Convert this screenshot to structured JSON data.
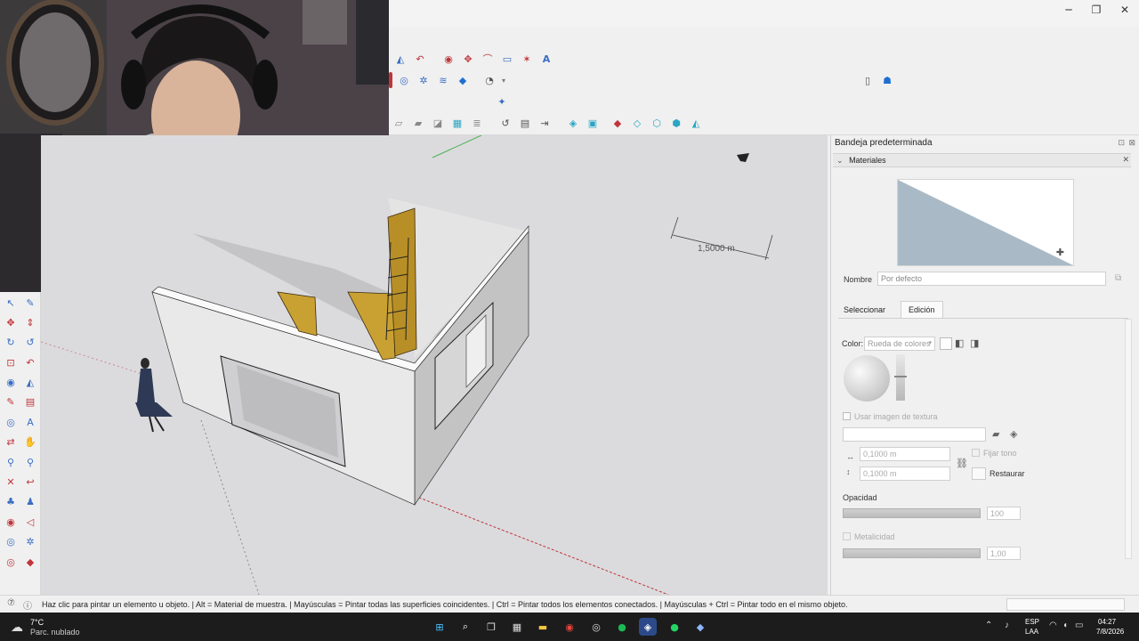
{
  "window": {
    "minimize_glyph": "─",
    "maximize_glyph": "❐",
    "close_glyph": "✕"
  },
  "toolbar": {
    "row1_icons": [
      "protractor-icon",
      "arc-icon",
      "tape-icon",
      "dimension-icon",
      "pie-icon",
      "text-icon",
      "axes-icon",
      "3d-text-icon"
    ],
    "row2_icons": [
      "orbit-icon",
      "pan-icon",
      "zoom-icon",
      "paint-icon",
      "user-icon"
    ],
    "row3_icons": [
      "sandbox-icon",
      "stamp-icon",
      "drape-icon",
      "add-detail-icon",
      "flip-icon",
      "warehouse-icon",
      "extension-icon"
    ],
    "right_icons": [
      "document-icon",
      "profile-icon"
    ]
  },
  "left_tools": [
    "select-icon",
    "pencil-icon",
    "move-icon",
    "push-pull-icon",
    "rotate-icon",
    "follow-me-icon",
    "scale-icon",
    "offset-icon",
    "tape-measure-icon",
    "protractor-icon",
    "paint-bucket-icon",
    "text-icon",
    "orbit-icon",
    "axes-icon",
    "section-plane-icon",
    "pan-icon",
    "zoom-icon",
    "zoom-window-icon",
    "zoom-extents-icon",
    "previous-view-icon",
    "position-camera-icon",
    "walk-icon",
    "look-around-icon",
    "section-display-icon",
    "warehouse-icon",
    "components-icon",
    "materials-icon",
    "styles-icon"
  ],
  "viewport": {
    "dimension_label": "1,5000 m",
    "colors": {
      "background": "#dbdbde",
      "wall_face": "#ececec",
      "wall_side": "#b8b8b8",
      "wood": "#c9a133",
      "axis_red": "#c0353a",
      "axis_green": "#4caf50"
    }
  },
  "tray": {
    "title": "Bandeja predeterminada",
    "section": "Materiales",
    "name_label": "Nombre",
    "name_value": "Por defecto",
    "tabs": [
      "Seleccionar",
      "Edición"
    ],
    "active_tab": "Edición",
    "color_label": "Color:",
    "color_mode": "Rueda de colores",
    "texture_checkbox": "Usar imagen de textura",
    "width_value": "0,1000 m",
    "height_value": "0,1000 m",
    "fix_tone": "Fijar tono",
    "restore": "Restaurar",
    "opacity_label": "Opacidad",
    "opacity_value": "100",
    "metal_label": "Metalicidad",
    "metal_value": "1,00",
    "preview_color": "#a9bac6"
  },
  "status": {
    "text": "Haz clic para pintar un elemento u objeto. | Alt = Material de muestra. | Mayúsculas = Pintar todas las superficies coincidentes. | Ctrl = Pintar todos los elementos conectados. | Mayúsculas + Ctrl = Pintar todo en el mismo objeto."
  },
  "taskbar": {
    "weather_temp": "7°C",
    "weather_desc": "Parc. nublado",
    "lang": "ESP",
    "lang2": "LAA",
    "time": "04:27",
    "date": "7/8/2026",
    "apps": [
      "start-icon",
      "search-icon",
      "task-view-icon",
      "store-icon",
      "explorer-icon",
      "chrome-icon",
      "obs-icon",
      "spotify-icon",
      "sketchup-icon",
      "whatsapp-icon",
      "layout-icon"
    ]
  }
}
